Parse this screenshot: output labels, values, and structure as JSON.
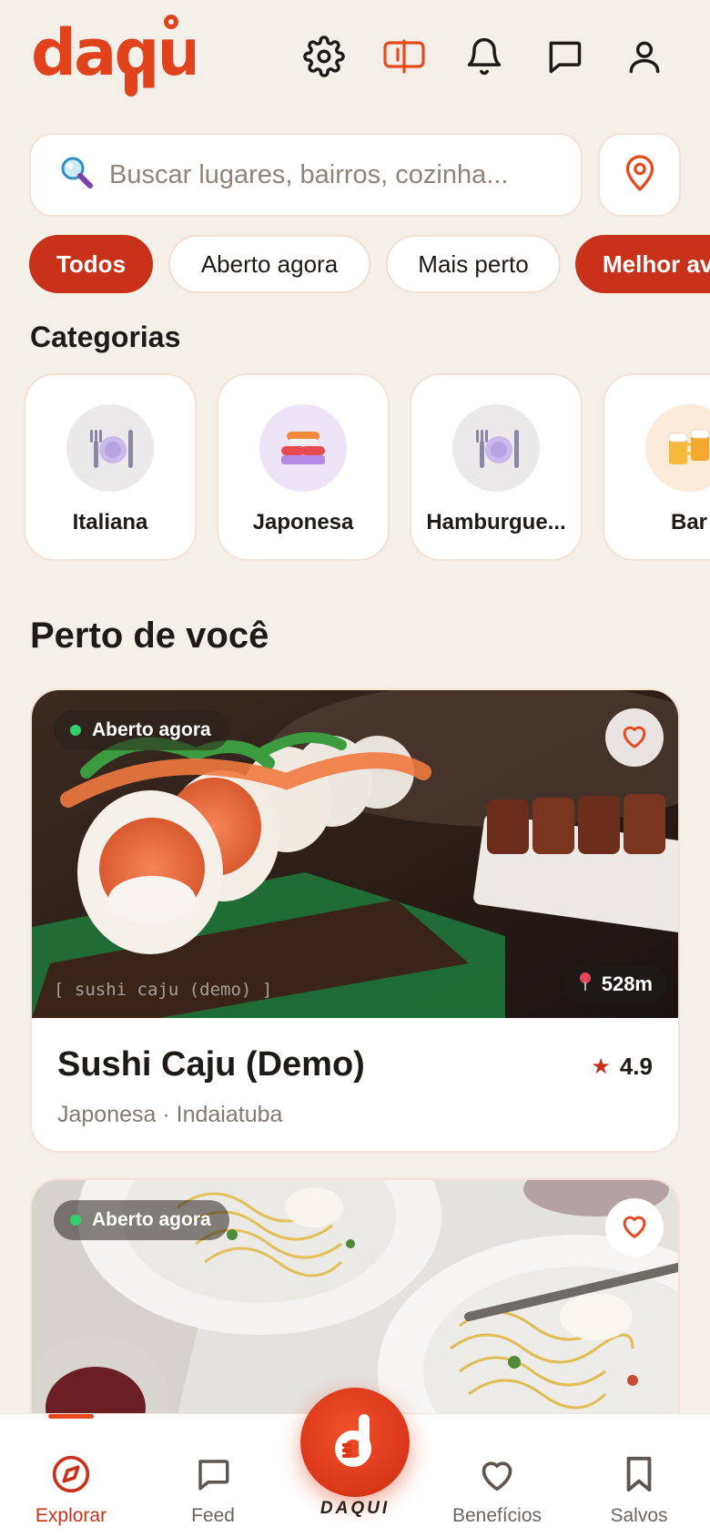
{
  "app": {
    "logo_text": "daqui"
  },
  "header": {
    "icons": [
      "gear-icon",
      "map-icon",
      "bell-icon",
      "chat-icon",
      "user-icon"
    ],
    "accent": "#E8491E"
  },
  "search": {
    "placeholder": "Buscar lugares, bairros, cozinha...",
    "value": ""
  },
  "filters": [
    {
      "label": "Todos",
      "active": true
    },
    {
      "label": "Aberto agora",
      "active": false
    },
    {
      "label": "Mais perto",
      "active": false
    },
    {
      "label": "Melhor av",
      "active": true
    }
  ],
  "categories": {
    "title": "Categorias",
    "items": [
      {
        "label": "Italiana",
        "icon": "plate-cutlery-icon"
      },
      {
        "label": "Japonesa",
        "icon": "sushi-icon"
      },
      {
        "label": "Hamburgue...",
        "icon": "plate-cutlery-icon"
      },
      {
        "label": "Bar",
        "icon": "beer-icon"
      }
    ]
  },
  "nearby": {
    "title": "Perto de você",
    "cards": [
      {
        "open_label": "Aberto agora",
        "caption": "[ sushi caju (demo) ]",
        "distance": "528m",
        "name": "Sushi Caju (Demo)",
        "subtitle": "Japonesa · Indaiatuba",
        "rating": "4.9"
      },
      {
        "open_label": "Aberto agora"
      }
    ]
  },
  "bottom_nav": {
    "items": [
      {
        "label": "Explorar",
        "icon": "compass-icon",
        "active": true
      },
      {
        "label": "Feed",
        "icon": "chat-icon",
        "active": false
      },
      {
        "label": "Benefícios",
        "icon": "heart-icon",
        "active": false
      },
      {
        "label": "Salvos",
        "icon": "bookmark-icon",
        "active": false
      }
    ],
    "center_label": "DAQUI"
  }
}
